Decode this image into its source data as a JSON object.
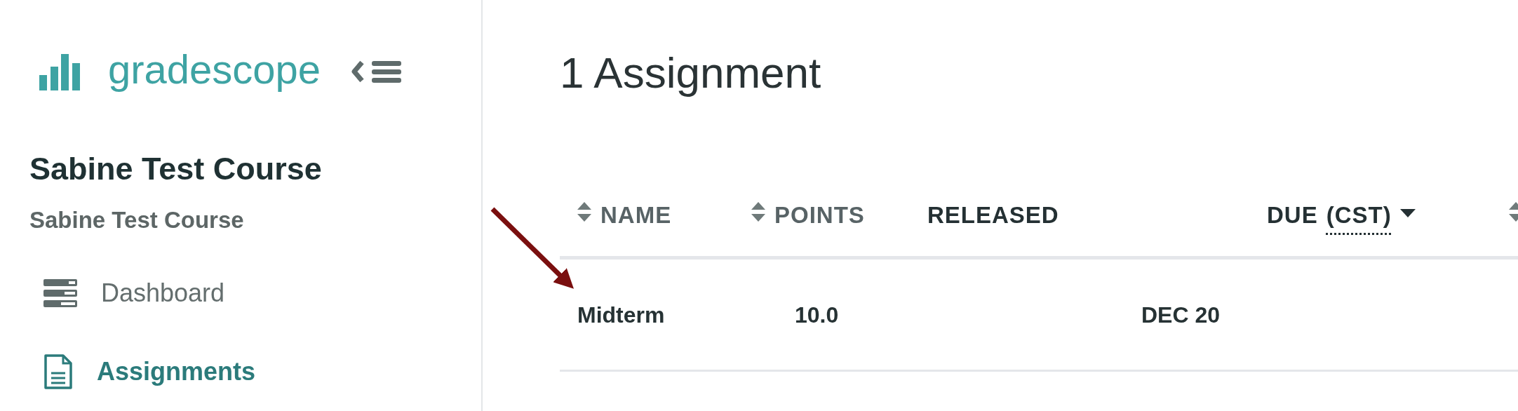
{
  "sidebar": {
    "logo": "gradescope",
    "course_title": "Sabine Test Course",
    "course_subtitle": "Sabine Test Course",
    "items": [
      {
        "kind": "dashboard",
        "label": "Dashboard",
        "selected": false
      },
      {
        "kind": "assignments",
        "label": "Assignments",
        "selected": true
      }
    ]
  },
  "main": {
    "heading": "1 Assignment",
    "table": {
      "columns": [
        {
          "label": "NAME",
          "sortable": true,
          "sorted_descending": false
        },
        {
          "label": "POINTS",
          "sortable": true,
          "sorted_descending": false
        },
        {
          "label": "RELEASED",
          "sortable": false,
          "sorted_descending": false
        },
        {
          "label": "DUE",
          "abbreviation": "(CST)",
          "sortable": false,
          "sorted_descending": true
        },
        {
          "sortable": true,
          "sorted_descending": false
        }
      ],
      "rows": [
        {
          "name": "Midterm",
          "points": "10.0",
          "due": "DEC 20"
        }
      ]
    }
  }
}
